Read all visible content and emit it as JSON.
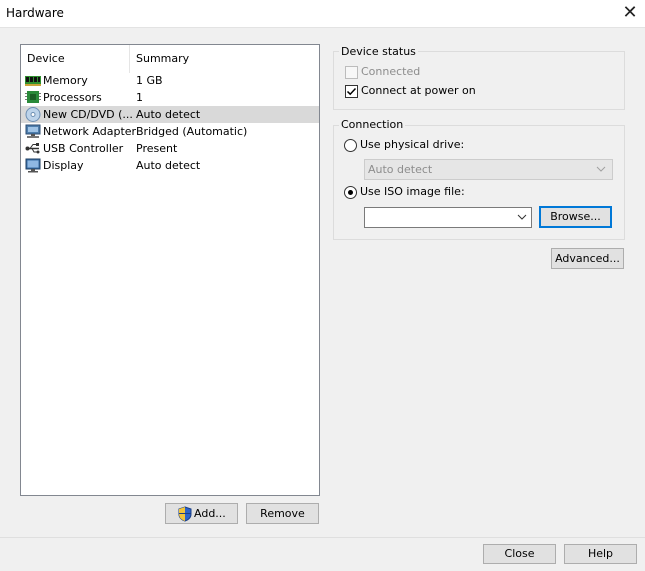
{
  "window": {
    "title": "Hardware"
  },
  "device_list": {
    "columns": {
      "device": "Device",
      "summary": "Summary"
    },
    "items": [
      {
        "name": "Memory",
        "summary": "1 GB",
        "icon": "memory-icon"
      },
      {
        "name": "Processors",
        "summary": "1",
        "icon": "processor-icon"
      },
      {
        "name": "New CD/DVD (...",
        "summary": "Auto detect",
        "icon": "cd-dvd-icon",
        "selected": true
      },
      {
        "name": "Network Adapter",
        "summary": "Bridged (Automatic)",
        "icon": "network-adapter-icon"
      },
      {
        "name": "USB Controller",
        "summary": "Present",
        "icon": "usb-icon"
      },
      {
        "name": "Display",
        "summary": "Auto detect",
        "icon": "display-icon"
      }
    ]
  },
  "buttons": {
    "add": "Add...",
    "remove": "Remove",
    "close": "Close",
    "help": "Help",
    "advanced": "Advanced...",
    "browse": "Browse..."
  },
  "device_status": {
    "legend": "Device status",
    "connected": {
      "label": "Connected",
      "checked": false,
      "disabled": true
    },
    "connect_at_power_on": {
      "label": "Connect at power on",
      "checked": true
    }
  },
  "connection": {
    "legend": "Connection",
    "use_physical_drive": {
      "label": "Use physical drive:",
      "selected": false
    },
    "physical_drive_value": "Auto detect",
    "use_iso_image": {
      "label": "Use ISO image file:",
      "selected": true
    },
    "iso_path_value": ""
  }
}
